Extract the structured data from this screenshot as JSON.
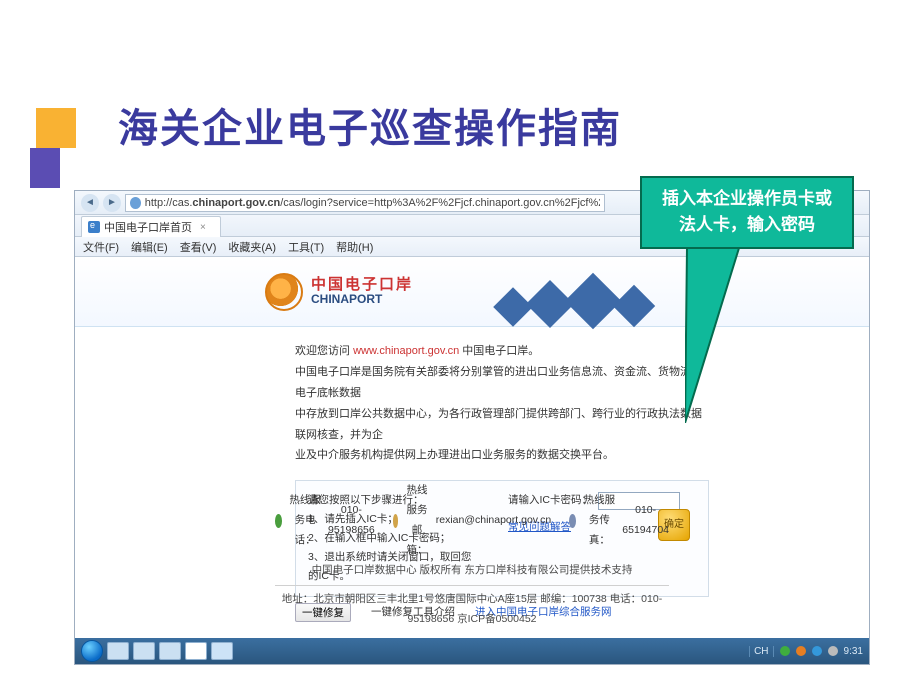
{
  "slide": {
    "title": "海关企业电子巡查操作指南"
  },
  "callout": {
    "line1": "插入本企业操作员卡或",
    "line2": "法人卡，输入密码"
  },
  "browser": {
    "url_host": "chinaport.gov.cn",
    "url_prefix": "http://cas.",
    "url_suffix": "/cas/login?service=http%3A%2F%2Fjcf.chinaport.gov.cn%2Fjcf%2Findex.jsp",
    "tab_title": "中国电子口岸首页",
    "menus": {
      "file": "文件(F)",
      "edit": "编辑(E)",
      "view": "查看(V)",
      "fav": "收藏夹(A)",
      "tools": "工具(T)",
      "help": "帮助(H)"
    }
  },
  "page": {
    "logo_cn": "中国电子口岸",
    "logo_en": "CHINAPORT",
    "welcome_prefix": "欢迎您访问 ",
    "welcome_url": "www.chinaport.gov.cn",
    "welcome_suffix": " 中国电子口岸。",
    "intro_l1": "中国电子口岸是国务院有关部委将分别掌管的进出口业务信息流、资金流、货物流等电子底帐数据",
    "intro_l2": "中存放到口岸公共数据中心，为各行政管理部门提供跨部门、跨行业的行政执法数据联网核查，并为企",
    "intro_l3": "业及中介服务机构提供网上办理进出口业务服务的数据交换平台。",
    "instr_title": "请您按照以下步骤进行：",
    "step1": "1、请先插入IC卡；",
    "step2": "2、在输入框中输入IC卡密码；",
    "step3": "3、退出系统时请关闭窗口，取回您的IC卡。",
    "pw_label": "请输入IC卡密码：",
    "ok_label": "确定",
    "faq_link": "常见问题解答",
    "repair_btn": "一键修复",
    "repair_tool_link": "一键修复工具介绍",
    "portal_link": "进入中国电子口岸综合服务网"
  },
  "footer": {
    "hot_phone_label": "热线服务电话：",
    "hot_phone": "010-95198656",
    "hot_mail_label": "热线服务邮箱：",
    "hot_mail": "rexian@chinaport.gov.cn",
    "hot_fax_label": "热线服务传真：",
    "hot_fax": "010-65194704",
    "copyright": "中国电子口岸数据中心 版权所有 东方口岸科技有限公司提供技术支持",
    "address": "地址：北京市朝阳区三丰北里1号悠唐国际中心A座15层 邮编：100738 电话：010-95198656 京ICP备0500452"
  },
  "taskbar": {
    "lang": "CH",
    "time": "9:31"
  }
}
